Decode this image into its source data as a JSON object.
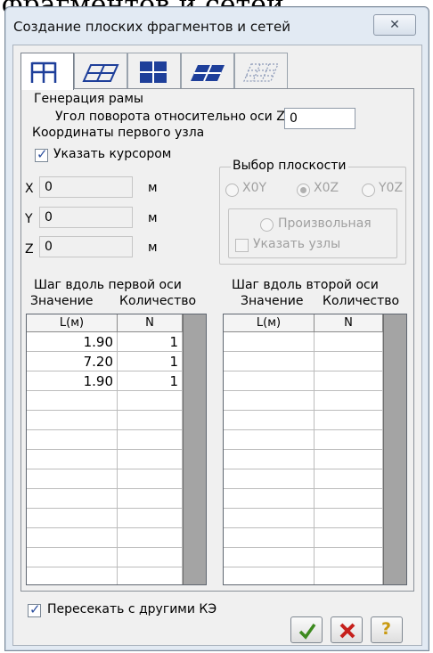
{
  "background_caption": "фрагментов и сетей",
  "window": {
    "title": "Создание плоских фрагментов и сетей",
    "close_glyph": "✕"
  },
  "tabs": [
    {
      "icon": "frame-grid-icon",
      "active": true
    },
    {
      "icon": "plate-grid-icon",
      "active": false
    },
    {
      "icon": "square-grid-icon",
      "active": false
    },
    {
      "icon": "skewed-plate-icon",
      "active": false
    },
    {
      "icon": "dotted-grid-icon",
      "active": false
    }
  ],
  "generation": {
    "title": "Генерация рамы",
    "rotation_label": "Угол поворота относительно оси Z",
    "rotation_value": "0"
  },
  "first_node": {
    "title": "Координаты первого узла",
    "cursor_label": "Указать курсором",
    "cursor_checked": true,
    "x_label": "X",
    "x_value": "0",
    "y_label": "Y",
    "y_value": "0",
    "z_label": "Z",
    "z_value": "0",
    "unit": "м"
  },
  "plane": {
    "title": "Выбор плоскости",
    "options": [
      "X0Y",
      "X0Z",
      "Y0Z"
    ],
    "selected": "X0Z",
    "arbitrary_label": "Произвольная",
    "nodes_label": "Указать узлы"
  },
  "axis1": {
    "title": "Шаг вдоль первой оси",
    "col_value": "Значение",
    "col_count": "Количество",
    "head_l": "L(м)",
    "head_n": "N",
    "rows": [
      {
        "l": "1.90",
        "n": "1"
      },
      {
        "l": "7.20",
        "n": "1"
      },
      {
        "l": "1.90",
        "n": "1"
      },
      {
        "l": "",
        "n": ""
      },
      {
        "l": "",
        "n": ""
      },
      {
        "l": "",
        "n": ""
      },
      {
        "l": "",
        "n": ""
      },
      {
        "l": "",
        "n": ""
      },
      {
        "l": "",
        "n": ""
      },
      {
        "l": "",
        "n": ""
      },
      {
        "l": "",
        "n": ""
      },
      {
        "l": "",
        "n": ""
      },
      {
        "l": "",
        "n": ""
      }
    ]
  },
  "axis2": {
    "title": "Шаг вдоль второй оси",
    "col_value": "Значение",
    "col_count": "Количество",
    "head_l": "L(м)",
    "head_n": "N",
    "rows": [
      {
        "l": "",
        "n": ""
      },
      {
        "l": "",
        "n": ""
      },
      {
        "l": "",
        "n": ""
      },
      {
        "l": "",
        "n": ""
      },
      {
        "l": "",
        "n": ""
      },
      {
        "l": "",
        "n": ""
      },
      {
        "l": "",
        "n": ""
      },
      {
        "l": "",
        "n": ""
      },
      {
        "l": "",
        "n": ""
      },
      {
        "l": "",
        "n": ""
      },
      {
        "l": "",
        "n": ""
      },
      {
        "l": "",
        "n": ""
      },
      {
        "l": "",
        "n": ""
      }
    ]
  },
  "intersect": {
    "label": "Пересекать с другими КЭ",
    "checked": true
  },
  "buttons": {
    "ok_icon": "checkmark-icon",
    "cancel_icon": "cross-icon",
    "help_icon": "question-icon",
    "help_glyph": "?"
  },
  "colors": {
    "ok_green": "#3d8a1f",
    "cancel_red": "#c6201c",
    "help_yellow": "#c99a12",
    "tab_icon_blue": "#1e3f9a"
  }
}
